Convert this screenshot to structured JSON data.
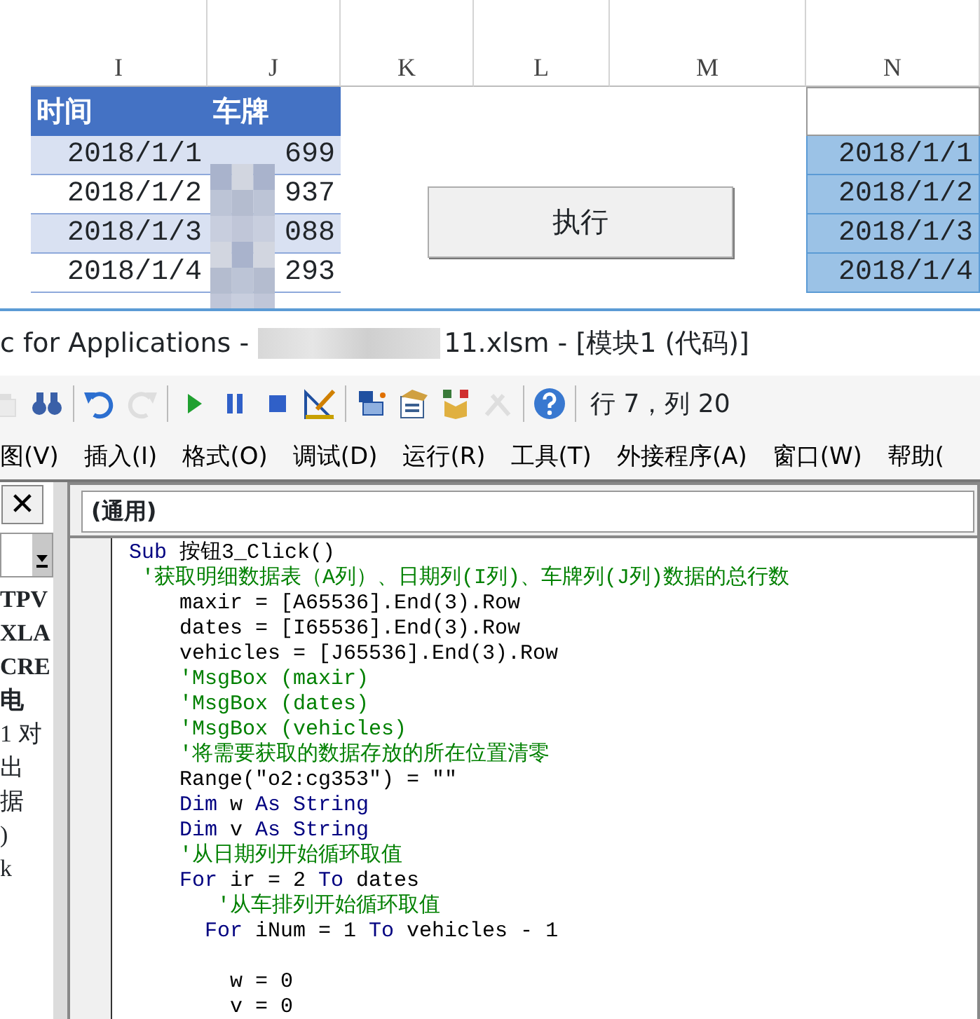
{
  "sheet": {
    "columns": [
      "I",
      "J",
      "K",
      "L",
      "M",
      "N"
    ],
    "headers": [
      "时间",
      "车牌"
    ],
    "rows": [
      {
        "date": "2018/1/1",
        "plate": "699",
        "shaded": true
      },
      {
        "date": "2018/1/2",
        "plate": "937",
        "shaded": false
      },
      {
        "date": "2018/1/3",
        "plate": "088",
        "shaded": true
      },
      {
        "date": "2018/1/4",
        "plate": "293",
        "shaded": false
      }
    ],
    "column_n": [
      "2018/1/1",
      "2018/1/2",
      "2018/1/3",
      "2018/1/4"
    ],
    "button": "执行"
  },
  "vba": {
    "title_start": "c for Applications -",
    "title_end": "11.xlsm - [模块1 (代码)]",
    "toolbar": [
      {
        "kind": "paste",
        "disabled": true
      },
      {
        "kind": "find",
        "disabled": false
      },
      {
        "kind": "separator"
      },
      {
        "kind": "undo",
        "disabled": false
      },
      {
        "kind": "redo",
        "disabled": true
      },
      {
        "kind": "separator"
      },
      {
        "kind": "run",
        "disabled": false
      },
      {
        "kind": "pause",
        "disabled": false
      },
      {
        "kind": "stop",
        "disabled": false
      },
      {
        "kind": "design",
        "disabled": false
      },
      {
        "kind": "separator"
      },
      {
        "kind": "project",
        "disabled": false
      },
      {
        "kind": "properties",
        "disabled": false
      },
      {
        "kind": "browser",
        "disabled": false
      },
      {
        "kind": "toolbox",
        "disabled": true
      },
      {
        "kind": "separator"
      },
      {
        "kind": "help",
        "disabled": false
      },
      {
        "kind": "separator"
      }
    ],
    "position": "行 7，列 20",
    "menu": [
      "图(V)",
      "插入(I)",
      "格式(O)",
      "调试(D)",
      "运行(R)",
      "工具(T)",
      "外接程序(A)",
      "窗口(W)",
      "帮助("
    ],
    "close": "✕",
    "project_items": [
      {
        "text": "TPV",
        "bold": true
      },
      {
        "text": "XLA",
        "bold": true
      },
      {
        "text": "CRE",
        "bold": true
      },
      {
        "text": "电",
        "bold": true
      },
      {
        "text": "1 对",
        "bold": false
      },
      {
        "text": "出",
        "bold": false
      },
      {
        "text": "据",
        "bold": false
      },
      {
        "text": ")",
        "bold": false
      },
      {
        "text": "k",
        "bold": false
      }
    ],
    "object_box": "(通用)",
    "code": [
      {
        "segments": [
          {
            "kind": "keyword",
            "text": "Sub"
          },
          {
            "kind": "plain",
            "text": " 按钮3_Click()"
          }
        ]
      },
      {
        "segments": [
          {
            "kind": "comment",
            "text": " '获取明细数据表（A列）、日期列(I列)、车牌列(J列)数据的总行数"
          }
        ]
      },
      {
        "segments": [
          {
            "kind": "plain",
            "text": "    maxir = [A65536].End(3).Row"
          }
        ]
      },
      {
        "segments": [
          {
            "kind": "plain",
            "text": "    dates = [I65536].End(3).Row"
          }
        ]
      },
      {
        "segments": [
          {
            "kind": "plain",
            "text": "    vehicles = [J65536].End(3).Row"
          }
        ]
      },
      {
        "segments": [
          {
            "kind": "comment",
            "text": "    'MsgBox (maxir)"
          }
        ]
      },
      {
        "segments": [
          {
            "kind": "comment",
            "text": "    'MsgBox (dates)"
          }
        ]
      },
      {
        "segments": [
          {
            "kind": "comment",
            "text": "    'MsgBox (vehicles)"
          }
        ]
      },
      {
        "segments": [
          {
            "kind": "comment",
            "text": "    '将需要获取的数据存放的所在位置清零"
          }
        ]
      },
      {
        "segments": [
          {
            "kind": "plain",
            "text": "    Range(\"o2:cg353\") = \"\""
          }
        ]
      },
      {
        "segments": [
          {
            "kind": "keyword",
            "text": "    Dim"
          },
          {
            "kind": "plain",
            "text": " w "
          },
          {
            "kind": "keyword",
            "text": "As String"
          }
        ]
      },
      {
        "segments": [
          {
            "kind": "keyword",
            "text": "    Dim"
          },
          {
            "kind": "plain",
            "text": " v "
          },
          {
            "kind": "keyword",
            "text": "As String"
          }
        ]
      },
      {
        "segments": [
          {
            "kind": "comment",
            "text": "    '从日期列开始循环取值"
          }
        ]
      },
      {
        "segments": [
          {
            "kind": "keyword",
            "text": "    For"
          },
          {
            "kind": "plain",
            "text": " ir = 2 "
          },
          {
            "kind": "keyword",
            "text": "To"
          },
          {
            "kind": "plain",
            "text": " dates"
          }
        ]
      },
      {
        "segments": [
          {
            "kind": "comment",
            "text": "       '从车排列开始循环取值"
          }
        ]
      },
      {
        "segments": [
          {
            "kind": "keyword",
            "text": "      For"
          },
          {
            "kind": "plain",
            "text": " iNum = 1 "
          },
          {
            "kind": "keyword",
            "text": "To"
          },
          {
            "kind": "plain",
            "text": " vehicles - 1"
          }
        ]
      },
      {
        "blank_before": true,
        "segments": [
          {
            "kind": "plain",
            "text": "        w = 0"
          }
        ]
      },
      {
        "segments": [
          {
            "kind": "plain",
            "text": "        v = 0"
          }
        ]
      }
    ]
  }
}
